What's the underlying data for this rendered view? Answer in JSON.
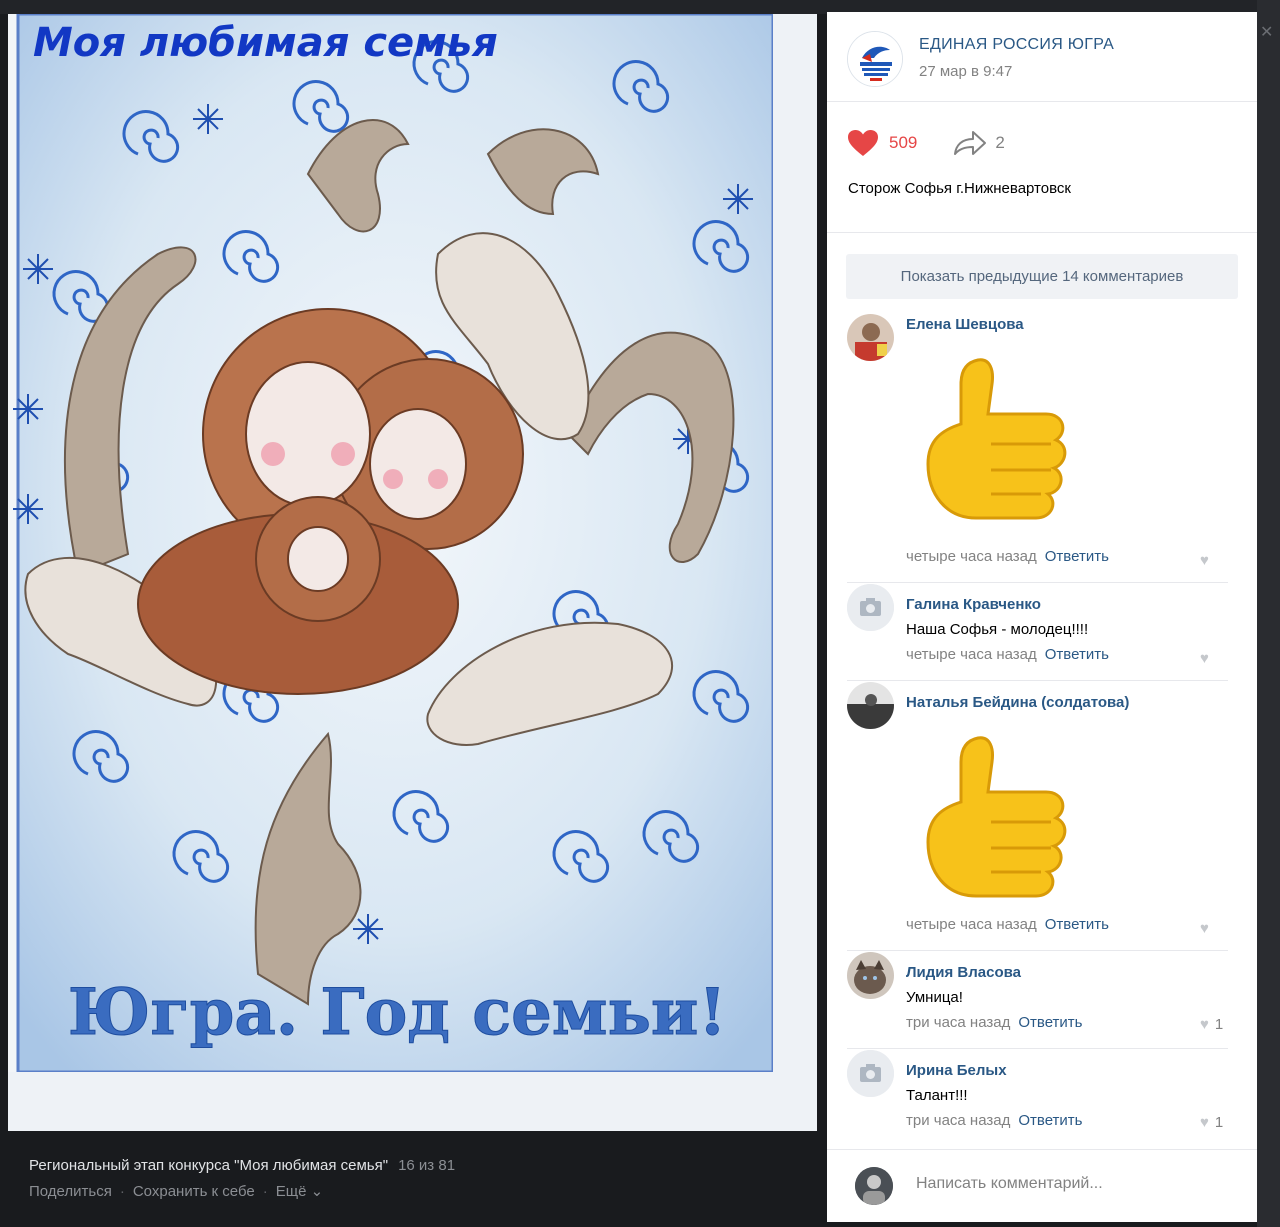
{
  "photo": {
    "drawing_title": "Моя любимая семья",
    "drawing_caption": "Югра. Год семьи!",
    "album_title": "Региональный этап конкурса \"Моя любимая семья\"",
    "counter": "16 из 81",
    "actions": {
      "share": "Поделиться",
      "save": "Сохранить к себе",
      "more": "Ещё"
    }
  },
  "owner": {
    "name": "ЕДИНАЯ РОССИЯ ЮГРА",
    "date": "27 мар в 9:47",
    "avatar_icon": "party-logo-icon"
  },
  "stats": {
    "likes": "509",
    "shares": "2",
    "like_color": "#e64646"
  },
  "description": "Сторож Софья г.Нижневартовск",
  "show_previous_label": "Показать предыдущие 14 комментариев",
  "comments": [
    {
      "author": "Елена Шевцова",
      "text": "",
      "sticker": "thumbs-up-sticker",
      "time": "четыре часа назад",
      "reply": "Ответить",
      "likes": ""
    },
    {
      "author": "Галина Кравченко",
      "text": "Наша Софья - молодец!!!!",
      "time": "четыре часа назад",
      "reply": "Ответить",
      "likes": ""
    },
    {
      "author": "Наталья Бейдина (солдатова)",
      "text": "",
      "sticker": "thumbs-up-sticker",
      "time": "четыре часа назад",
      "reply": "Ответить",
      "likes": ""
    },
    {
      "author": "Лидия Власова",
      "text": "Умница!",
      "time": "три часа назад",
      "reply": "Ответить",
      "likes": "1"
    },
    {
      "author": "Ирина Белых",
      "text": "Талант!!!",
      "time": "три часа назад",
      "reply": "Ответить",
      "likes": "1"
    }
  ],
  "compose": {
    "placeholder": "Написать комментарий..."
  },
  "colors": {
    "link": "#2a5885",
    "muted": "#828282",
    "background": "#191b1e"
  }
}
